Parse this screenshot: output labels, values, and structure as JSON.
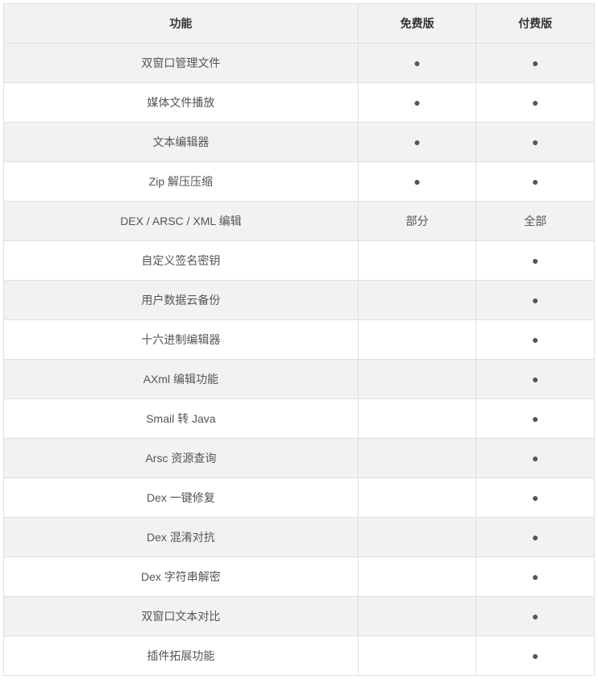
{
  "headers": {
    "col1": "功能",
    "col2": "免费版",
    "col3": "付费版"
  },
  "rows": [
    {
      "feature": "双窗口管理文件",
      "free": "●",
      "paid": "●"
    },
    {
      "feature": "媒体文件播放",
      "free": "●",
      "paid": "●"
    },
    {
      "feature": "文本编辑器",
      "free": "●",
      "paid": "●"
    },
    {
      "feature": "Zip 解压压缩",
      "free": "●",
      "paid": "●"
    },
    {
      "feature": "DEX / ARSC / XML 编辑",
      "free": "部分",
      "paid": "全部"
    },
    {
      "feature": "自定义签名密钥",
      "free": "",
      "paid": "●"
    },
    {
      "feature": "用户数据云备份",
      "free": "",
      "paid": "●"
    },
    {
      "feature": "十六进制编辑器",
      "free": "",
      "paid": "●"
    },
    {
      "feature": "AXml 编辑功能",
      "free": "",
      "paid": "●"
    },
    {
      "feature": "Smail 转 Java",
      "free": "",
      "paid": "●"
    },
    {
      "feature": "Arsc 资源查询",
      "free": "",
      "paid": "●"
    },
    {
      "feature": "Dex 一键修复",
      "free": "",
      "paid": "●"
    },
    {
      "feature": "Dex 混淆对抗",
      "free": "",
      "paid": "●"
    },
    {
      "feature": "Dex 字符串解密",
      "free": "",
      "paid": "●"
    },
    {
      "feature": "双窗口文本对比",
      "free": "",
      "paid": "●"
    },
    {
      "feature": "插件拓展功能",
      "free": "",
      "paid": "●"
    }
  ]
}
